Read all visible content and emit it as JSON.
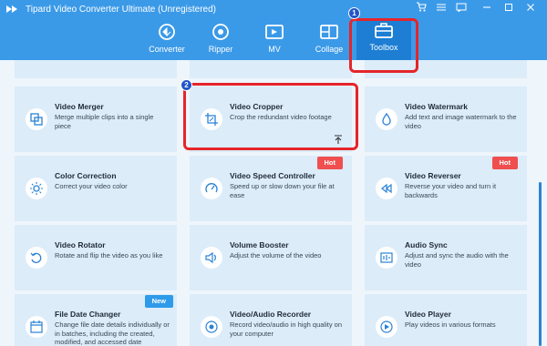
{
  "app": {
    "title": "Tipard Video Converter Ultimate (Unregistered)"
  },
  "nav": [
    {
      "label": "Converter",
      "icon": "converter-icon"
    },
    {
      "label": "Ripper",
      "icon": "ripper-icon"
    },
    {
      "label": "MV",
      "icon": "mv-icon"
    },
    {
      "label": "Collage",
      "icon": "collage-icon"
    },
    {
      "label": "Toolbox",
      "icon": "toolbox-icon",
      "active": true
    }
  ],
  "window_controls": [
    "cart-icon",
    "menu-icon",
    "feedback-icon",
    "minimize-icon",
    "maximize-icon",
    "close-icon"
  ],
  "tools": [
    {
      "title": "Video Merger",
      "desc": "Merge multiple clips into a single piece",
      "icon": "merge-icon"
    },
    {
      "title": "Video Cropper",
      "desc": "Crop the redundant video footage",
      "icon": "crop-icon"
    },
    {
      "title": "Video Watermark",
      "desc": "Add text and image watermark to the video",
      "icon": "watermark-icon"
    },
    {
      "title": "Color Correction",
      "desc": "Correct your video color",
      "icon": "color-icon"
    },
    {
      "title": "Video Speed Controller",
      "desc": "Speed up or slow down your file at ease",
      "icon": "speed-icon",
      "badge": "Hot"
    },
    {
      "title": "Video Reverser",
      "desc": "Reverse your video and turn it backwards",
      "icon": "reverse-icon",
      "badge": "Hot"
    },
    {
      "title": "Video Rotator",
      "desc": "Rotate and flip the video as you like",
      "icon": "rotate-icon"
    },
    {
      "title": "Volume Booster",
      "desc": "Adjust the volume of the video",
      "icon": "volume-icon"
    },
    {
      "title": "Audio Sync",
      "desc": "Adjust and sync the audio with the video",
      "icon": "audio-sync-icon"
    },
    {
      "title": "File Date Changer",
      "desc": "Change file date details individually or in batches, including the created, modified, and accessed date",
      "icon": "date-icon",
      "badge": "New"
    },
    {
      "title": "Video/Audio Recorder",
      "desc": "Record video/audio in high quality on your computer",
      "icon": "recorder-icon"
    },
    {
      "title": "Video Player",
      "desc": "Play videos in various formats",
      "icon": "player-icon"
    }
  ],
  "annotations": {
    "step1": "1",
    "step2": "2"
  },
  "colors": {
    "header": "#3b9ae8",
    "card": "#dcecf9",
    "highlight": "#e5252a",
    "hot": "#f04f4f",
    "new": "#2e9bea"
  }
}
